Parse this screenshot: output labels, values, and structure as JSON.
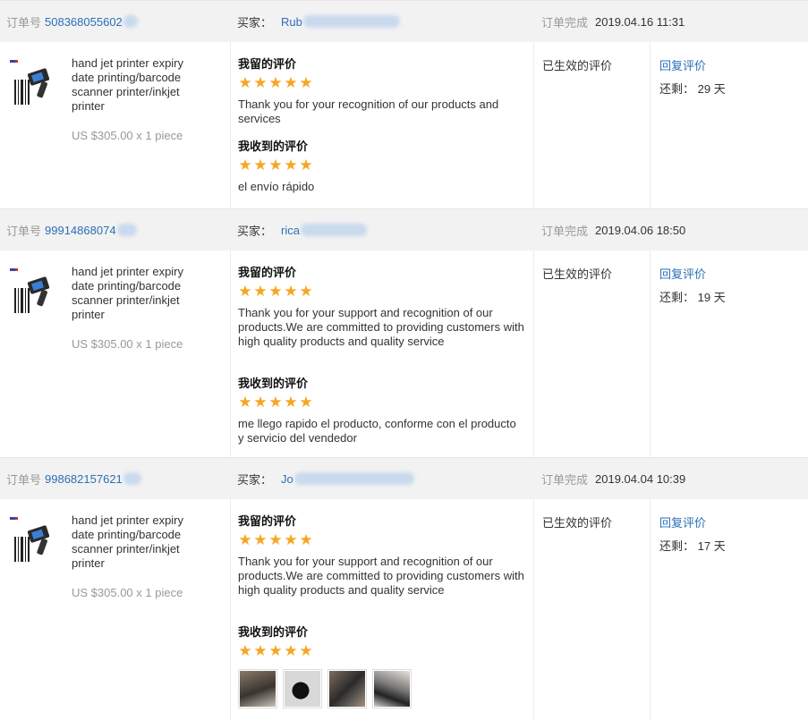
{
  "labels": {
    "order_no": "订单号",
    "buyer": "买家：",
    "completed": "订单完成",
    "my_review": "我留的评价",
    "received_review": "我收到的评价",
    "effective": "已生效的评价",
    "reply": "回复评价",
    "remaining": "还剩："
  },
  "product": {
    "title": "hand jet printer expiry date printing/barcode scanner printer/inkjet printer",
    "price": "US $305.00 x 1 piece"
  },
  "orders": [
    {
      "order_no": "508368055602",
      "buyer": "Rub",
      "completed_time": "2019.04.16 11:31",
      "my_review": "Thank you for your recognition of our products and services",
      "received_review": "el envío rápido",
      "remaining_days": "29 天",
      "my_stars": 5,
      "received_stars": 5
    },
    {
      "order_no": "99914868074",
      "buyer": "rica",
      "completed_time": "2019.04.06 18:50",
      "my_review": "Thank you for your support and recognition of our products.We are committed to providing customers with high quality products and quality service",
      "received_review": "me llego rapido el producto, conforme con el producto y servicio del vendedor",
      "remaining_days": "19 天",
      "my_stars": 5,
      "received_stars": 5
    },
    {
      "order_no": "998682157621",
      "buyer": "Jo",
      "completed_time": "2019.04.04 10:39",
      "my_review": "Thank you for your support and recognition of our products.We are committed to providing customers with high quality products and quality service",
      "received_review": "",
      "remaining_days": "17 天",
      "my_stars": 5,
      "received_stars": 5,
      "photo_count": 4
    }
  ],
  "colors": {
    "link": "#2b6fb6",
    "star": "#f5a623",
    "header_bg": "#f2f2f2"
  },
  "icons": [
    "star-icon",
    "printer-product-thumbnail",
    "review-photo"
  ]
}
